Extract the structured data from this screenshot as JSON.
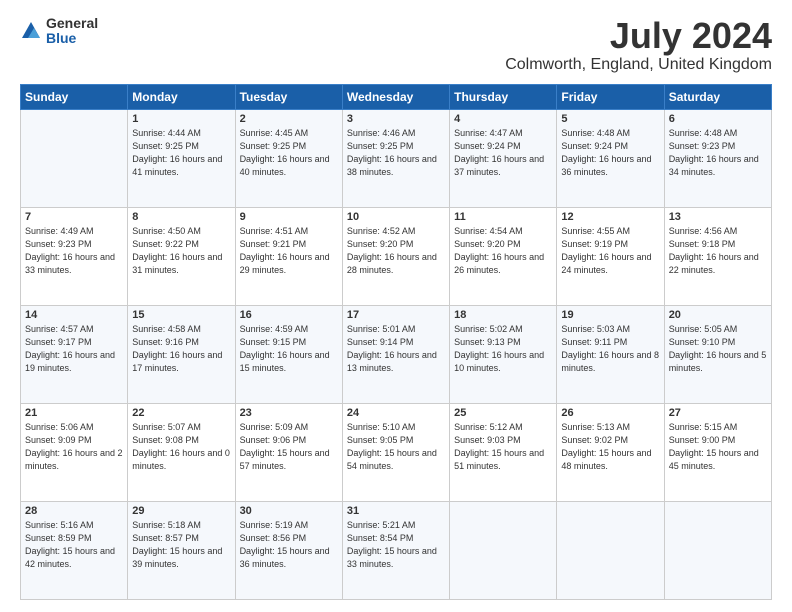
{
  "logo": {
    "general": "General",
    "blue": "Blue"
  },
  "title": "July 2024",
  "subtitle": "Colmworth, England, United Kingdom",
  "headers": [
    "Sunday",
    "Monday",
    "Tuesday",
    "Wednesday",
    "Thursday",
    "Friday",
    "Saturday"
  ],
  "weeks": [
    [
      {
        "day": "",
        "sunrise": "",
        "sunset": "",
        "daylight": ""
      },
      {
        "day": "1",
        "sunrise": "Sunrise: 4:44 AM",
        "sunset": "Sunset: 9:25 PM",
        "daylight": "Daylight: 16 hours and 41 minutes."
      },
      {
        "day": "2",
        "sunrise": "Sunrise: 4:45 AM",
        "sunset": "Sunset: 9:25 PM",
        "daylight": "Daylight: 16 hours and 40 minutes."
      },
      {
        "day": "3",
        "sunrise": "Sunrise: 4:46 AM",
        "sunset": "Sunset: 9:25 PM",
        "daylight": "Daylight: 16 hours and 38 minutes."
      },
      {
        "day": "4",
        "sunrise": "Sunrise: 4:47 AM",
        "sunset": "Sunset: 9:24 PM",
        "daylight": "Daylight: 16 hours and 37 minutes."
      },
      {
        "day": "5",
        "sunrise": "Sunrise: 4:48 AM",
        "sunset": "Sunset: 9:24 PM",
        "daylight": "Daylight: 16 hours and 36 minutes."
      },
      {
        "day": "6",
        "sunrise": "Sunrise: 4:48 AM",
        "sunset": "Sunset: 9:23 PM",
        "daylight": "Daylight: 16 hours and 34 minutes."
      }
    ],
    [
      {
        "day": "7",
        "sunrise": "Sunrise: 4:49 AM",
        "sunset": "Sunset: 9:23 PM",
        "daylight": "Daylight: 16 hours and 33 minutes."
      },
      {
        "day": "8",
        "sunrise": "Sunrise: 4:50 AM",
        "sunset": "Sunset: 9:22 PM",
        "daylight": "Daylight: 16 hours and 31 minutes."
      },
      {
        "day": "9",
        "sunrise": "Sunrise: 4:51 AM",
        "sunset": "Sunset: 9:21 PM",
        "daylight": "Daylight: 16 hours and 29 minutes."
      },
      {
        "day": "10",
        "sunrise": "Sunrise: 4:52 AM",
        "sunset": "Sunset: 9:20 PM",
        "daylight": "Daylight: 16 hours and 28 minutes."
      },
      {
        "day": "11",
        "sunrise": "Sunrise: 4:54 AM",
        "sunset": "Sunset: 9:20 PM",
        "daylight": "Daylight: 16 hours and 26 minutes."
      },
      {
        "day": "12",
        "sunrise": "Sunrise: 4:55 AM",
        "sunset": "Sunset: 9:19 PM",
        "daylight": "Daylight: 16 hours and 24 minutes."
      },
      {
        "day": "13",
        "sunrise": "Sunrise: 4:56 AM",
        "sunset": "Sunset: 9:18 PM",
        "daylight": "Daylight: 16 hours and 22 minutes."
      }
    ],
    [
      {
        "day": "14",
        "sunrise": "Sunrise: 4:57 AM",
        "sunset": "Sunset: 9:17 PM",
        "daylight": "Daylight: 16 hours and 19 minutes."
      },
      {
        "day": "15",
        "sunrise": "Sunrise: 4:58 AM",
        "sunset": "Sunset: 9:16 PM",
        "daylight": "Daylight: 16 hours and 17 minutes."
      },
      {
        "day": "16",
        "sunrise": "Sunrise: 4:59 AM",
        "sunset": "Sunset: 9:15 PM",
        "daylight": "Daylight: 16 hours and 15 minutes."
      },
      {
        "day": "17",
        "sunrise": "Sunrise: 5:01 AM",
        "sunset": "Sunset: 9:14 PM",
        "daylight": "Daylight: 16 hours and 13 minutes."
      },
      {
        "day": "18",
        "sunrise": "Sunrise: 5:02 AM",
        "sunset": "Sunset: 9:13 PM",
        "daylight": "Daylight: 16 hours and 10 minutes."
      },
      {
        "day": "19",
        "sunrise": "Sunrise: 5:03 AM",
        "sunset": "Sunset: 9:11 PM",
        "daylight": "Daylight: 16 hours and 8 minutes."
      },
      {
        "day": "20",
        "sunrise": "Sunrise: 5:05 AM",
        "sunset": "Sunset: 9:10 PM",
        "daylight": "Daylight: 16 hours and 5 minutes."
      }
    ],
    [
      {
        "day": "21",
        "sunrise": "Sunrise: 5:06 AM",
        "sunset": "Sunset: 9:09 PM",
        "daylight": "Daylight: 16 hours and 2 minutes."
      },
      {
        "day": "22",
        "sunrise": "Sunrise: 5:07 AM",
        "sunset": "Sunset: 9:08 PM",
        "daylight": "Daylight: 16 hours and 0 minutes."
      },
      {
        "day": "23",
        "sunrise": "Sunrise: 5:09 AM",
        "sunset": "Sunset: 9:06 PM",
        "daylight": "Daylight: 15 hours and 57 minutes."
      },
      {
        "day": "24",
        "sunrise": "Sunrise: 5:10 AM",
        "sunset": "Sunset: 9:05 PM",
        "daylight": "Daylight: 15 hours and 54 minutes."
      },
      {
        "day": "25",
        "sunrise": "Sunrise: 5:12 AM",
        "sunset": "Sunset: 9:03 PM",
        "daylight": "Daylight: 15 hours and 51 minutes."
      },
      {
        "day": "26",
        "sunrise": "Sunrise: 5:13 AM",
        "sunset": "Sunset: 9:02 PM",
        "daylight": "Daylight: 15 hours and 48 minutes."
      },
      {
        "day": "27",
        "sunrise": "Sunrise: 5:15 AM",
        "sunset": "Sunset: 9:00 PM",
        "daylight": "Daylight: 15 hours and 45 minutes."
      }
    ],
    [
      {
        "day": "28",
        "sunrise": "Sunrise: 5:16 AM",
        "sunset": "Sunset: 8:59 PM",
        "daylight": "Daylight: 15 hours and 42 minutes."
      },
      {
        "day": "29",
        "sunrise": "Sunrise: 5:18 AM",
        "sunset": "Sunset: 8:57 PM",
        "daylight": "Daylight: 15 hours and 39 minutes."
      },
      {
        "day": "30",
        "sunrise": "Sunrise: 5:19 AM",
        "sunset": "Sunset: 8:56 PM",
        "daylight": "Daylight: 15 hours and 36 minutes."
      },
      {
        "day": "31",
        "sunrise": "Sunrise: 5:21 AM",
        "sunset": "Sunset: 8:54 PM",
        "daylight": "Daylight: 15 hours and 33 minutes."
      },
      {
        "day": "",
        "sunrise": "",
        "sunset": "",
        "daylight": ""
      },
      {
        "day": "",
        "sunrise": "",
        "sunset": "",
        "daylight": ""
      },
      {
        "day": "",
        "sunrise": "",
        "sunset": "",
        "daylight": ""
      }
    ]
  ]
}
